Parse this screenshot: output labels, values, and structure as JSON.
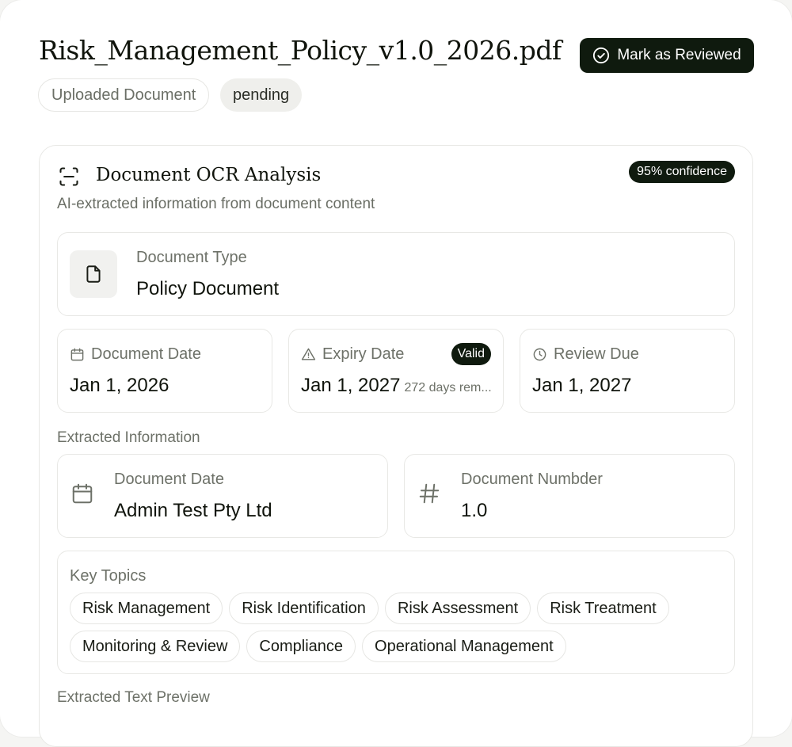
{
  "header": {
    "title": "Risk_Management_Policy_v1.0_2026.pdf",
    "review_button": "Mark as Reviewed",
    "source_chip": "Uploaded Document",
    "status_chip": "pending"
  },
  "ocr": {
    "title": "Document OCR Analysis",
    "confidence": "95% confidence",
    "subtitle": "AI-extracted information from document content",
    "document_type": {
      "label": "Document Type",
      "value": "Policy Document"
    },
    "dates": {
      "document_date": {
        "label": "Document Date",
        "value": "Jan 1, 2026"
      },
      "expiry_date": {
        "label": "Expiry Date",
        "value": "Jan 1, 2027",
        "badge": "Valid",
        "remaining": "272 days rem..."
      },
      "review_due": {
        "label": "Review Due",
        "value": "Jan 1, 2027"
      }
    },
    "extracted": {
      "section_label": "Extracted Information",
      "fields": [
        {
          "label": "Document Date",
          "value": "Admin Test Pty Ltd"
        },
        {
          "label": "Document Numbder",
          "value": "1.0"
        }
      ]
    },
    "key_topics": {
      "label": "Key Topics",
      "tags": [
        "Risk Management",
        "Risk Identification",
        "Risk Assessment",
        "Risk Treatment",
        "Monitoring & Review",
        "Compliance",
        "Operational Management"
      ]
    },
    "preview_label": "Extracted Text Preview"
  },
  "colors": {
    "accent": "#0f1a0e",
    "muted": "#6d7168",
    "border": "#e8e8e5"
  }
}
